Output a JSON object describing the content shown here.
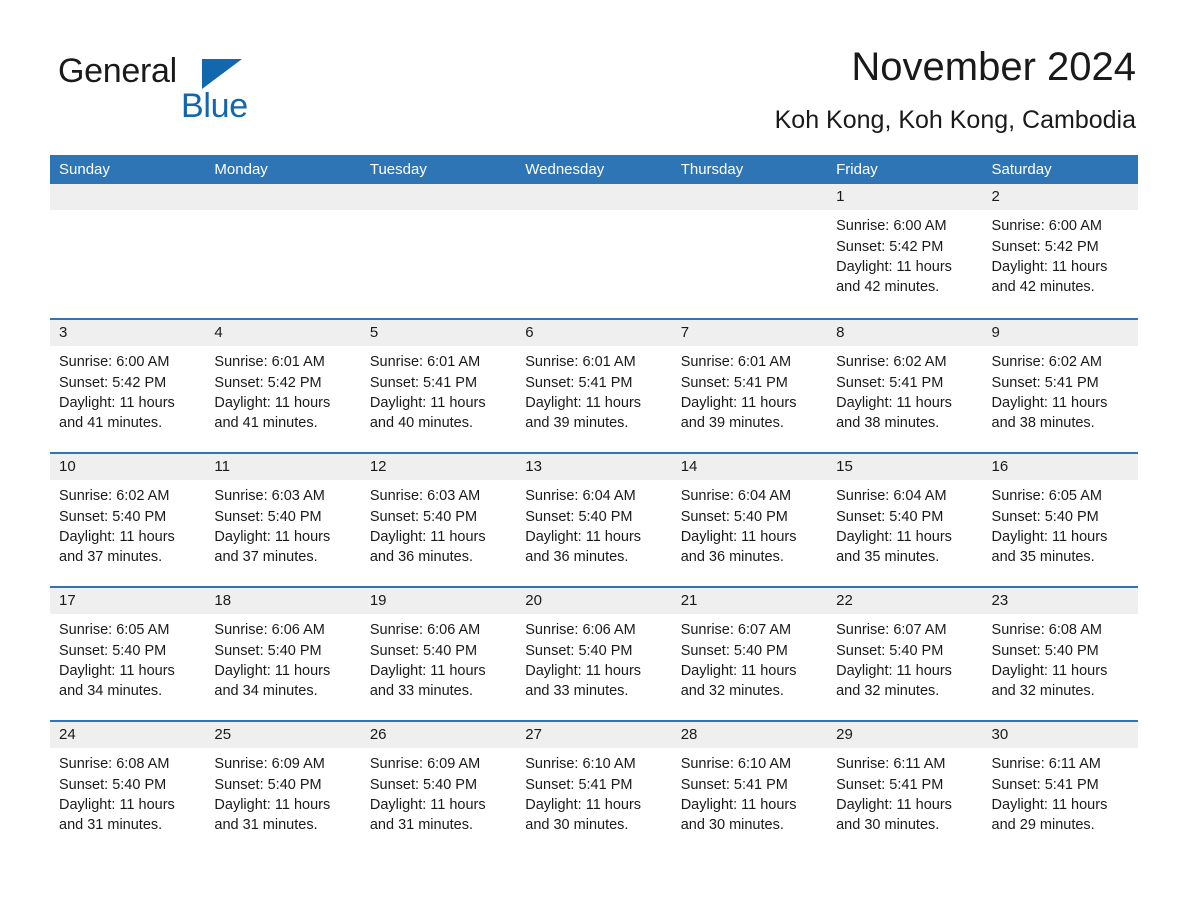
{
  "brand": {
    "name_part1": "General",
    "name_part2": "Blue",
    "accent_color": "#1267ad"
  },
  "header": {
    "title": "November 2024",
    "subtitle": "Koh Kong, Koh Kong, Cambodia",
    "header_bg_color": "#2e75b6",
    "day_band_color": "#efefef"
  },
  "weekdays": [
    "Sunday",
    "Monday",
    "Tuesday",
    "Wednesday",
    "Thursday",
    "Friday",
    "Saturday"
  ],
  "weeks": [
    [
      {
        "day": "",
        "sunrise": "",
        "sunset": "",
        "daylight": ""
      },
      {
        "day": "",
        "sunrise": "",
        "sunset": "",
        "daylight": ""
      },
      {
        "day": "",
        "sunrise": "",
        "sunset": "",
        "daylight": ""
      },
      {
        "day": "",
        "sunrise": "",
        "sunset": "",
        "daylight": ""
      },
      {
        "day": "",
        "sunrise": "",
        "sunset": "",
        "daylight": ""
      },
      {
        "day": "1",
        "sunrise": "Sunrise: 6:00 AM",
        "sunset": "Sunset: 5:42 PM",
        "daylight": "Daylight: 11 hours and 42 minutes."
      },
      {
        "day": "2",
        "sunrise": "Sunrise: 6:00 AM",
        "sunset": "Sunset: 5:42 PM",
        "daylight": "Daylight: 11 hours and 42 minutes."
      }
    ],
    [
      {
        "day": "3",
        "sunrise": "Sunrise: 6:00 AM",
        "sunset": "Sunset: 5:42 PM",
        "daylight": "Daylight: 11 hours and 41 minutes."
      },
      {
        "day": "4",
        "sunrise": "Sunrise: 6:01 AM",
        "sunset": "Sunset: 5:42 PM",
        "daylight": "Daylight: 11 hours and 41 minutes."
      },
      {
        "day": "5",
        "sunrise": "Sunrise: 6:01 AM",
        "sunset": "Sunset: 5:41 PM",
        "daylight": "Daylight: 11 hours and 40 minutes."
      },
      {
        "day": "6",
        "sunrise": "Sunrise: 6:01 AM",
        "sunset": "Sunset: 5:41 PM",
        "daylight": "Daylight: 11 hours and 39 minutes."
      },
      {
        "day": "7",
        "sunrise": "Sunrise: 6:01 AM",
        "sunset": "Sunset: 5:41 PM",
        "daylight": "Daylight: 11 hours and 39 minutes."
      },
      {
        "day": "8",
        "sunrise": "Sunrise: 6:02 AM",
        "sunset": "Sunset: 5:41 PM",
        "daylight": "Daylight: 11 hours and 38 minutes."
      },
      {
        "day": "9",
        "sunrise": "Sunrise: 6:02 AM",
        "sunset": "Sunset: 5:41 PM",
        "daylight": "Daylight: 11 hours and 38 minutes."
      }
    ],
    [
      {
        "day": "10",
        "sunrise": "Sunrise: 6:02 AM",
        "sunset": "Sunset: 5:40 PM",
        "daylight": "Daylight: 11 hours and 37 minutes."
      },
      {
        "day": "11",
        "sunrise": "Sunrise: 6:03 AM",
        "sunset": "Sunset: 5:40 PM",
        "daylight": "Daylight: 11 hours and 37 minutes."
      },
      {
        "day": "12",
        "sunrise": "Sunrise: 6:03 AM",
        "sunset": "Sunset: 5:40 PM",
        "daylight": "Daylight: 11 hours and 36 minutes."
      },
      {
        "day": "13",
        "sunrise": "Sunrise: 6:04 AM",
        "sunset": "Sunset: 5:40 PM",
        "daylight": "Daylight: 11 hours and 36 minutes."
      },
      {
        "day": "14",
        "sunrise": "Sunrise: 6:04 AM",
        "sunset": "Sunset: 5:40 PM",
        "daylight": "Daylight: 11 hours and 36 minutes."
      },
      {
        "day": "15",
        "sunrise": "Sunrise: 6:04 AM",
        "sunset": "Sunset: 5:40 PM",
        "daylight": "Daylight: 11 hours and 35 minutes."
      },
      {
        "day": "16",
        "sunrise": "Sunrise: 6:05 AM",
        "sunset": "Sunset: 5:40 PM",
        "daylight": "Daylight: 11 hours and 35 minutes."
      }
    ],
    [
      {
        "day": "17",
        "sunrise": "Sunrise: 6:05 AM",
        "sunset": "Sunset: 5:40 PM",
        "daylight": "Daylight: 11 hours and 34 minutes."
      },
      {
        "day": "18",
        "sunrise": "Sunrise: 6:06 AM",
        "sunset": "Sunset: 5:40 PM",
        "daylight": "Daylight: 11 hours and 34 minutes."
      },
      {
        "day": "19",
        "sunrise": "Sunrise: 6:06 AM",
        "sunset": "Sunset: 5:40 PM",
        "daylight": "Daylight: 11 hours and 33 minutes."
      },
      {
        "day": "20",
        "sunrise": "Sunrise: 6:06 AM",
        "sunset": "Sunset: 5:40 PM",
        "daylight": "Daylight: 11 hours and 33 minutes."
      },
      {
        "day": "21",
        "sunrise": "Sunrise: 6:07 AM",
        "sunset": "Sunset: 5:40 PM",
        "daylight": "Daylight: 11 hours and 32 minutes."
      },
      {
        "day": "22",
        "sunrise": "Sunrise: 6:07 AM",
        "sunset": "Sunset: 5:40 PM",
        "daylight": "Daylight: 11 hours and 32 minutes."
      },
      {
        "day": "23",
        "sunrise": "Sunrise: 6:08 AM",
        "sunset": "Sunset: 5:40 PM",
        "daylight": "Daylight: 11 hours and 32 minutes."
      }
    ],
    [
      {
        "day": "24",
        "sunrise": "Sunrise: 6:08 AM",
        "sunset": "Sunset: 5:40 PM",
        "daylight": "Daylight: 11 hours and 31 minutes."
      },
      {
        "day": "25",
        "sunrise": "Sunrise: 6:09 AM",
        "sunset": "Sunset: 5:40 PM",
        "daylight": "Daylight: 11 hours and 31 minutes."
      },
      {
        "day": "26",
        "sunrise": "Sunrise: 6:09 AM",
        "sunset": "Sunset: 5:40 PM",
        "daylight": "Daylight: 11 hours and 31 minutes."
      },
      {
        "day": "27",
        "sunrise": "Sunrise: 6:10 AM",
        "sunset": "Sunset: 5:41 PM",
        "daylight": "Daylight: 11 hours and 30 minutes."
      },
      {
        "day": "28",
        "sunrise": "Sunrise: 6:10 AM",
        "sunset": "Sunset: 5:41 PM",
        "daylight": "Daylight: 11 hours and 30 minutes."
      },
      {
        "day": "29",
        "sunrise": "Sunrise: 6:11 AM",
        "sunset": "Sunset: 5:41 PM",
        "daylight": "Daylight: 11 hours and 30 minutes."
      },
      {
        "day": "30",
        "sunrise": "Sunrise: 6:11 AM",
        "sunset": "Sunset: 5:41 PM",
        "daylight": "Daylight: 11 hours and 29 minutes."
      }
    ]
  ]
}
